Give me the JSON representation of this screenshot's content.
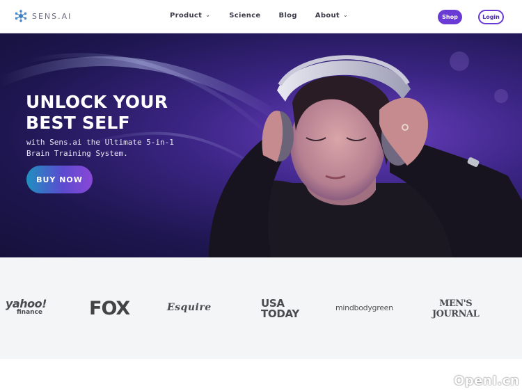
{
  "nav": {
    "logo_text": "SENS.AI",
    "menu": {
      "product": "Product",
      "science": "Science",
      "blog": "Blog",
      "about": "About"
    },
    "shop_label": "Shop",
    "login_label": "Login"
  },
  "hero": {
    "title_line1": "UNLOCK YOUR",
    "title_line2": "BEST SELF",
    "subtitle": "with Sens.ai the Ultimate 5-in-1 Brain Training System.",
    "cta_label": "BUY NOW"
  },
  "press": {
    "yahoo": "yahoo!",
    "yahoo_sub": "finance",
    "fox": "FOX",
    "esquire": "Esquire",
    "usa_line1": "USA",
    "usa_line2": "TODAY",
    "mbg": "mindbodygreen",
    "mj_line1": "MEN'S",
    "mj_line2": "JOURNAL"
  },
  "watermark": "OpenI.cn",
  "colors": {
    "accent": "#6a3bd4",
    "hero_bg": "#2a1d6a",
    "press_bg": "#f4f5f7"
  }
}
